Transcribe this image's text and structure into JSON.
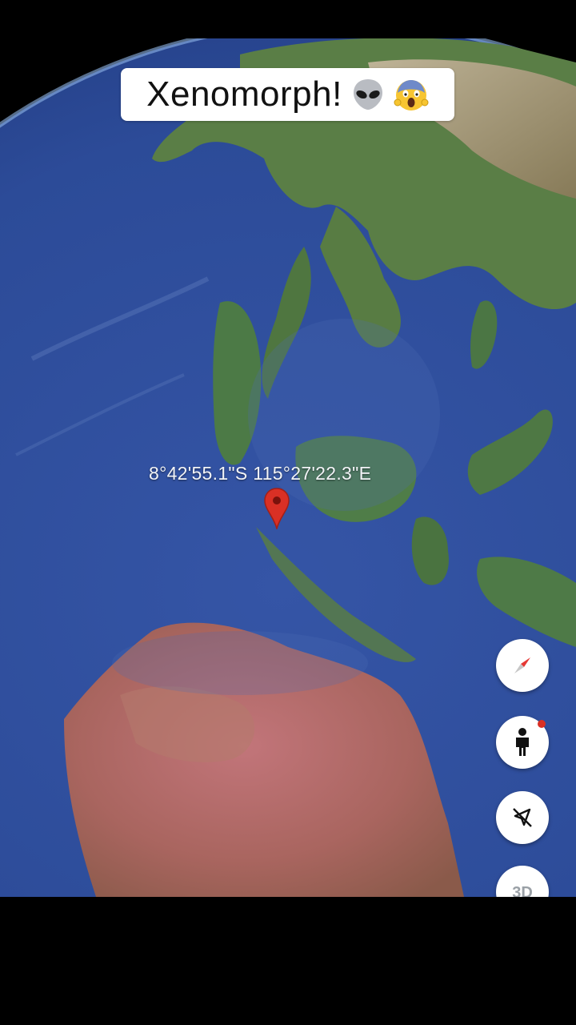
{
  "caption": {
    "text": "Xenomorph!",
    "emojis": [
      "alien-emoji",
      "screaming-face-emoji"
    ]
  },
  "map": {
    "coordinates_label": "8°42'55.1\"S 115°27'22.3\"E"
  },
  "controls": {
    "compass": {
      "icon": "compass-icon"
    },
    "street_view": {
      "icon": "pegman-icon"
    },
    "location": {
      "icon": "location-off-icon"
    },
    "view_3d": {
      "label": "3D"
    }
  },
  "colors": {
    "ocean": "#2f4f9e",
    "land_green": "#4f7a45",
    "land_red": "#b86a6e",
    "pin_red": "#d93025",
    "badge_red": "#d93025"
  }
}
